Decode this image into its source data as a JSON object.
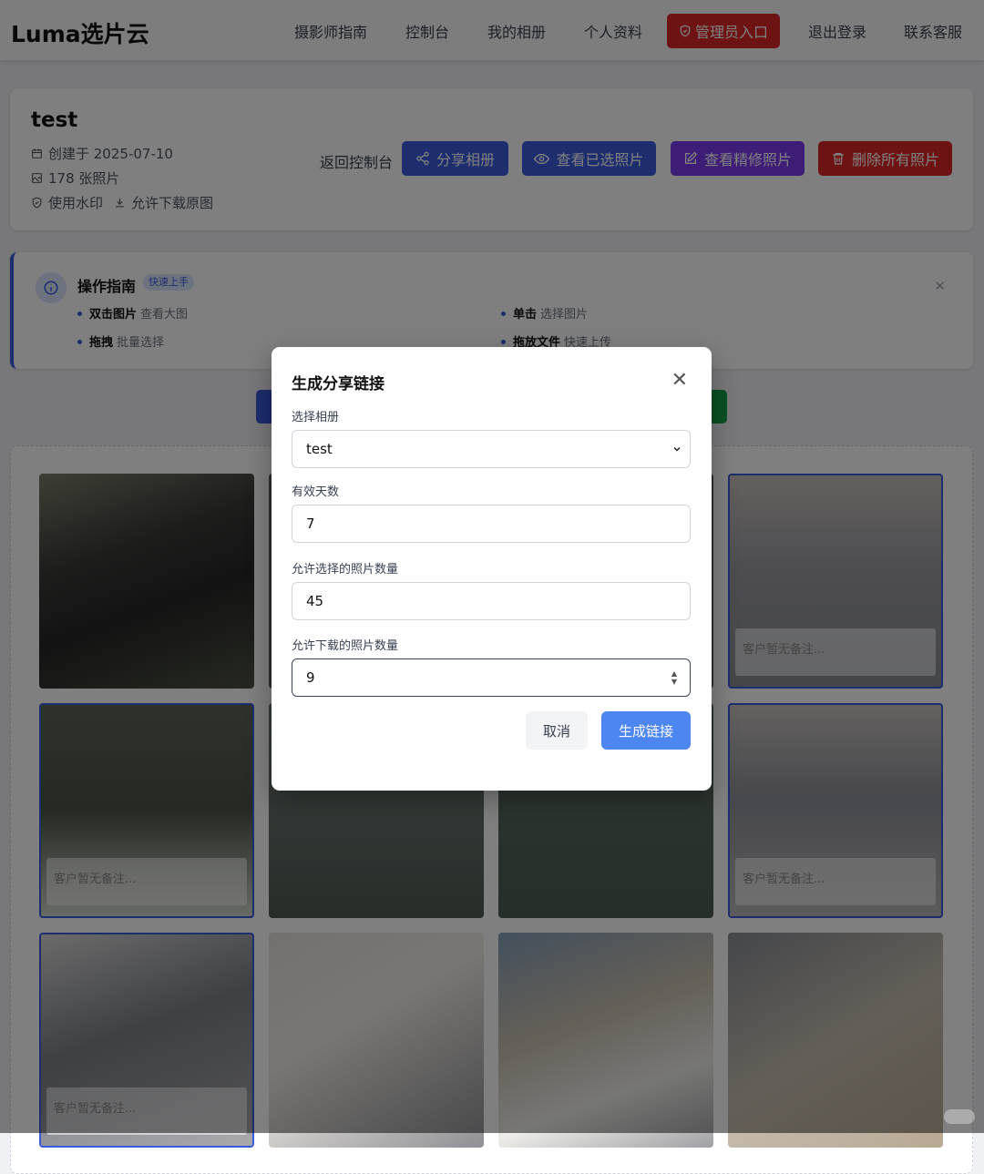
{
  "app": {
    "logo": "Luma选片云"
  },
  "nav": {
    "guide": "摄影师指南",
    "console": "控制台",
    "albums": "我的相册",
    "profile": "个人资料",
    "admin": "管理员入口",
    "logout": "退出登录",
    "support": "联系客服"
  },
  "album": {
    "title": "test",
    "created": "创建于 2025-07-10",
    "count": "178 张照片",
    "watermark": "使用水印",
    "download": "允许下载原图",
    "back": "返回控制台",
    "share": "分享相册",
    "view_selected": "查看已选照片",
    "view_retouched": "查看精修照片",
    "delete_all": "删除所有照片"
  },
  "guide": {
    "title": "操作指南",
    "badge": "快速上手",
    "tips": [
      {
        "key": "双击图片",
        "text": "查看大图"
      },
      {
        "key": "单击",
        "text": "选择图片"
      },
      {
        "key": "拖拽",
        "text": "批量选择"
      },
      {
        "key": "拖放文件",
        "text": "快速上传"
      }
    ]
  },
  "photos": {
    "note": "客户暂无备注..."
  },
  "modal": {
    "title": "生成分享链接",
    "album_label": "选择相册",
    "album_value": "test",
    "days_label": "有效天数",
    "days_value": "7",
    "select_label": "允许选择的照片数量",
    "select_value": "45",
    "download_label": "允许下载的照片数量",
    "download_value": "9",
    "cancel": "取消",
    "generate": "生成链接"
  },
  "colors": {
    "blue": "#3b5bdb",
    "purple": "#7c3aed",
    "red": "#dc2626",
    "modal_primary": "#4e86f1"
  }
}
